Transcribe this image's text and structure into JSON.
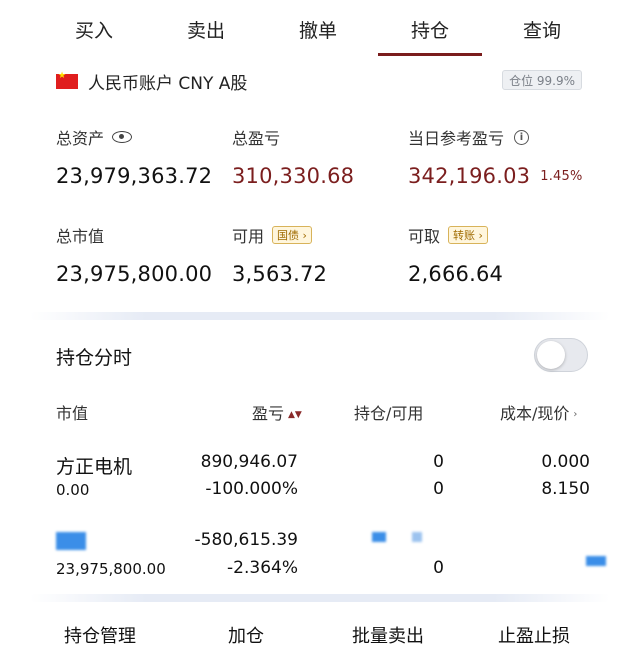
{
  "tabs": [
    "买入",
    "卖出",
    "撤单",
    "持仓",
    "查询"
  ],
  "active_tab": "持仓",
  "account": {
    "label": "人民币账户 CNY A股",
    "position_badge": "仓位 99.9%"
  },
  "summary": {
    "total_assets": {
      "label": "总资产",
      "value": "23,979,363.72"
    },
    "total_pnl": {
      "label": "总盈亏",
      "value": "310,330.68"
    },
    "daily_pnl": {
      "label": "当日参考盈亏",
      "value": "342,196.03",
      "percent": "1.45%"
    },
    "market_value": {
      "label": "总市值",
      "value": "23,975,800.00"
    },
    "available": {
      "label": "可用",
      "tag": "国债 ›",
      "value": "3,563.72"
    },
    "withdrawable": {
      "label": "可取",
      "tag": "转账 ›",
      "value": "2,666.64"
    }
  },
  "positions": {
    "title": "持仓分时",
    "toggle_on": false,
    "columns": {
      "market_value": "市值",
      "pnl": "盈亏",
      "holding": "持仓/可用",
      "cost": "成本/现价"
    },
    "rows": [
      {
        "name": "方正电机",
        "market_value": "0.00",
        "pnl": "890,946.07",
        "pnl_pct": "-100.000%",
        "holding": "0",
        "available": "0",
        "cost": "0.000",
        "price": "8.150"
      },
      {
        "name": "",
        "market_value": "23,975,800.00",
        "pnl": "-580,615.39",
        "pnl_pct": "-2.364%",
        "holding": "",
        "available": "0",
        "cost": "",
        "price": ""
      }
    ]
  },
  "actions": [
    "持仓管理",
    "加仓",
    "批量卖出",
    "止盈止损"
  ],
  "colors": {
    "accent": "#7a1c1c",
    "loss_red": "#7b1e1e",
    "tag_gold": "#a06b00"
  }
}
